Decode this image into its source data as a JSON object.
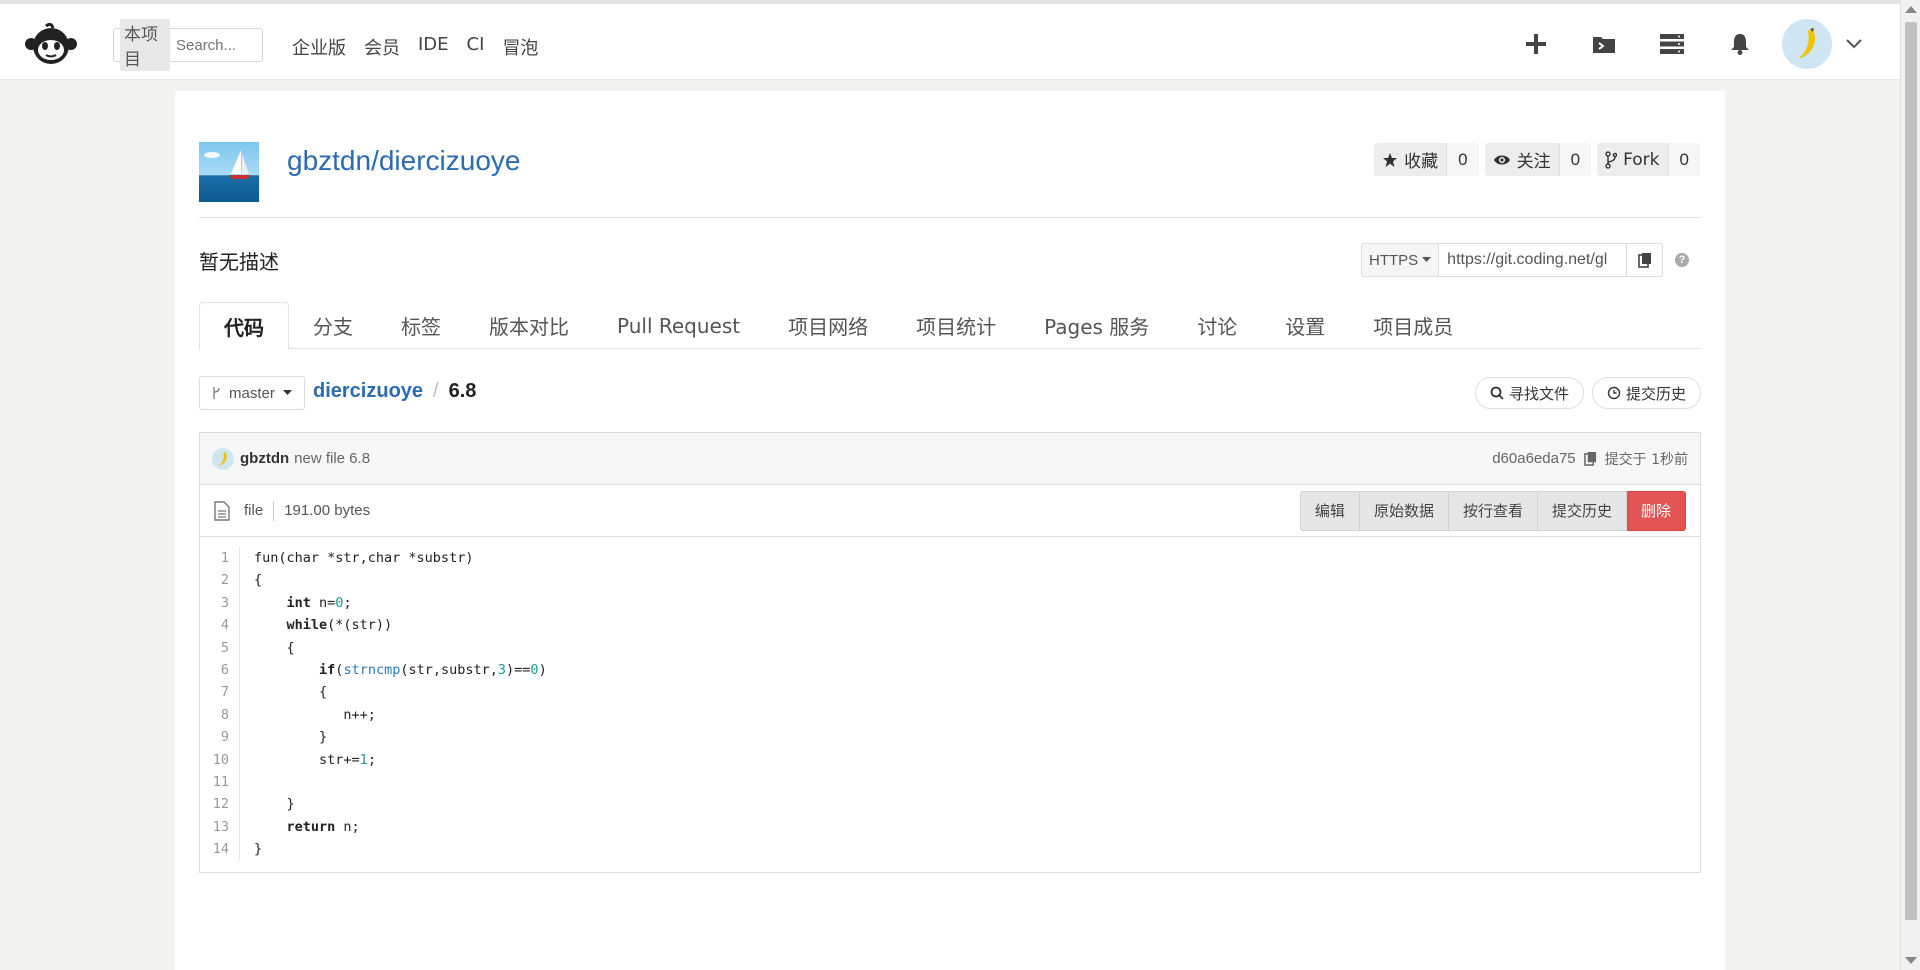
{
  "topnav": {
    "search_scope": "本项目",
    "search_placeholder": "Search...",
    "links": [
      "企业版",
      "会员",
      "IDE",
      "CI",
      "冒泡"
    ]
  },
  "project": {
    "full_name": "gbztdn/diercizuoye",
    "description": "暂无描述",
    "stats": [
      {
        "label": "收藏",
        "count": "0",
        "icon": "star-icon"
      },
      {
        "label": "关注",
        "count": "0",
        "icon": "eye-icon"
      },
      {
        "label": "Fork",
        "count": "0",
        "icon": "fork-icon"
      }
    ]
  },
  "clone": {
    "protocol": "HTTPS",
    "url": "https://git.coding.net/gl"
  },
  "tabs": [
    "代码",
    "分支",
    "标签",
    "版本对比",
    "Pull Request",
    "项目网络",
    "项目统计",
    "Pages 服务",
    "讨论",
    "设置",
    "项目成员"
  ],
  "active_tab": "代码",
  "branch": "master",
  "breadcrumb": {
    "repo": "diercizuoye",
    "separator": "/",
    "file": "6.8"
  },
  "file_actions": {
    "find_file": "寻找文件",
    "commit_history": "提交历史"
  },
  "commit": {
    "user": "gbztdn",
    "message": "new file 6.8",
    "hash": "d60a6eda75",
    "when": "提交于 1秒前"
  },
  "file": {
    "mode": "file",
    "size": "191.00 bytes",
    "buttons": {
      "edit": "编辑",
      "raw": "原始数据",
      "blame": "按行查看",
      "history": "提交历史",
      "delete": "删除"
    }
  },
  "code_lines": [
    "fun(char *str,char *substr)",
    "{",
    "    int n=0;",
    "    while(*(str))",
    "    {",
    "        if(strncmp(str,substr,3)==0)",
    "        {",
    "           n++;",
    "        }",
    "        str+=1;",
    "",
    "    }",
    "    return n;",
    "}"
  ],
  "colors": {
    "link_blue": "#2b6cb0",
    "delete_red": "#e25454"
  }
}
